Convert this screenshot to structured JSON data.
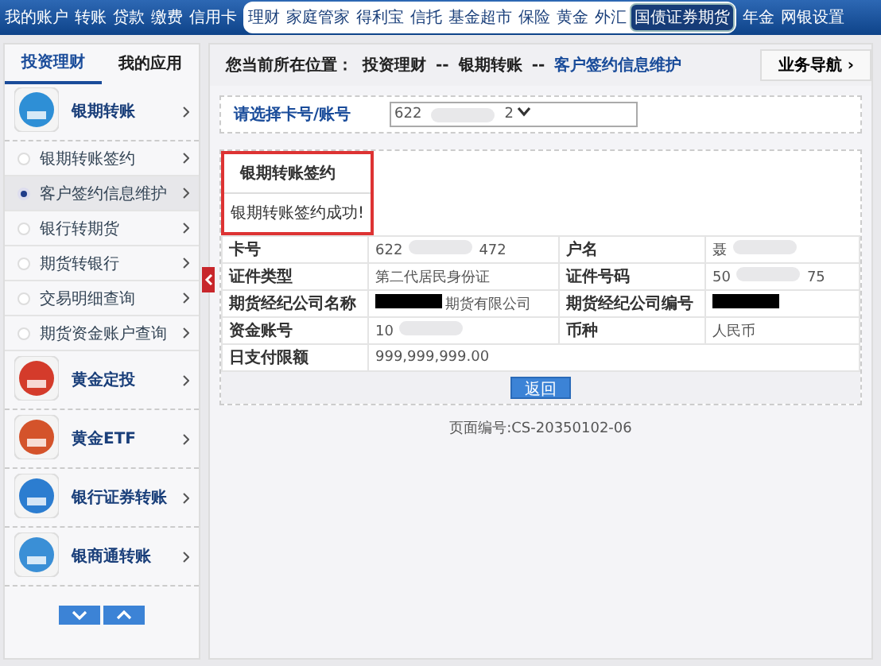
{
  "nav": {
    "left": [
      "我的账户",
      "转账",
      "贷款",
      "缴费",
      "信用卡"
    ],
    "center": [
      {
        "label": "理财",
        "selected": false
      },
      {
        "label": "家庭管家",
        "selected": false
      },
      {
        "label": "得利宝",
        "selected": false
      },
      {
        "label": "信托",
        "selected": false
      },
      {
        "label": "基金超市",
        "selected": false
      },
      {
        "label": "保险",
        "selected": false
      },
      {
        "label": "黄金",
        "selected": false
      },
      {
        "label": "外汇",
        "selected": false
      },
      {
        "label": "国债证券期货",
        "selected": true
      }
    ],
    "right": [
      "年金",
      "网银设置"
    ]
  },
  "sidebar": {
    "tabs": [
      {
        "label": "投资理财",
        "selected": true
      },
      {
        "label": "我的应用",
        "selected": false
      }
    ],
    "groups": [
      {
        "label": "银期转账",
        "children": [
          {
            "label": "银期转账签约",
            "selected": false
          },
          {
            "label": "客户签约信息维护",
            "selected": true
          },
          {
            "label": "银行转期货",
            "selected": false
          },
          {
            "label": "期货转银行",
            "selected": false
          },
          {
            "label": "交易明细查询",
            "selected": false
          },
          {
            "label": "期货资金账户查询",
            "selected": false
          }
        ]
      },
      {
        "label": "黄金定投"
      },
      {
        "label": "黄金ETF"
      },
      {
        "label": "银行证券转账"
      },
      {
        "label": "银商通转账"
      }
    ]
  },
  "breadcrumb": {
    "prefix": "您当前所在位置：",
    "path": [
      "投资理财",
      "银期转账",
      "客户签约信息维护"
    ],
    "separator": "--"
  },
  "guide_button": "业务导航 ›",
  "account_select": {
    "label": "请选择卡号/账号",
    "value": [
      {
        "kind": "text",
        "text": "622"
      },
      {
        "kind": "blur"
      },
      {
        "kind": "text",
        "text": "2"
      }
    ]
  },
  "result": {
    "title": "银期转账签约",
    "message": "银期转账签约成功!"
  },
  "details": [
    [
      {
        "label": "卡号",
        "value": [
          {
            "kind": "text",
            "text": "622"
          },
          {
            "kind": "blur"
          },
          {
            "kind": "text",
            "text": "472"
          }
        ]
      },
      {
        "label": "户名",
        "value": [
          {
            "kind": "text",
            "text": "聂"
          },
          {
            "kind": "blur"
          }
        ]
      }
    ],
    [
      {
        "label": "证件类型",
        "value": [
          {
            "kind": "text",
            "text": "第二代居民身份证"
          }
        ]
      },
      {
        "label": "证件号码",
        "value": [
          {
            "kind": "text",
            "text": "50"
          },
          {
            "kind": "blur"
          },
          {
            "kind": "text",
            "text": "75"
          }
        ]
      }
    ],
    [
      {
        "label": "期货经纪公司名称",
        "value": [
          {
            "kind": "redacted"
          },
          {
            "kind": "text",
            "text": "期货有限公司"
          }
        ]
      },
      {
        "label": "期货经纪公司编号",
        "value": [
          {
            "kind": "redacted"
          }
        ]
      }
    ],
    [
      {
        "label": "资金账号",
        "value": [
          {
            "kind": "text",
            "text": "10"
          },
          {
            "kind": "blur"
          }
        ]
      },
      {
        "label": "币种",
        "value": [
          {
            "kind": "text",
            "text": "人民币"
          }
        ]
      }
    ],
    [
      {
        "label": "日支付限额",
        "value": [
          {
            "kind": "text",
            "text": "999,999,999.00"
          }
        ]
      }
    ]
  ],
  "back_button": "返回",
  "page_code": {
    "label": "页面编号",
    "value": ":CS-20350102-06"
  }
}
